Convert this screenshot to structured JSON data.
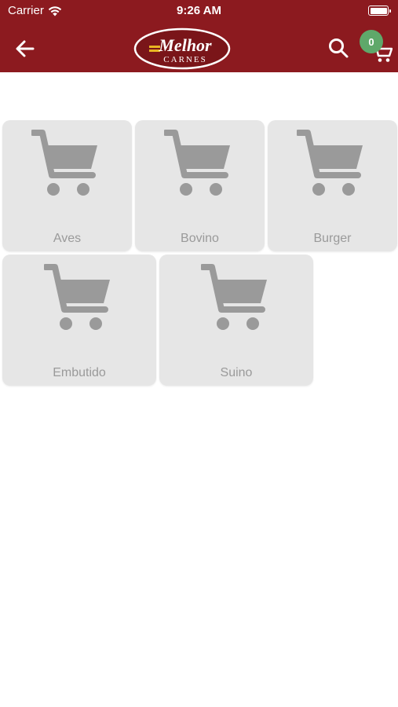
{
  "status_bar": {
    "carrier": "Carrier",
    "time": "9:26 AM",
    "wifi_icon": "wifi-icon",
    "battery_icon": "battery-icon"
  },
  "header": {
    "background_color": "#8c1a1f",
    "back_icon": "arrow-left-icon",
    "logo": {
      "text_top": "Melhor",
      "text_bottom": "CARNES"
    },
    "search_icon": "search-icon",
    "cart": {
      "icon": "cart-icon",
      "count": "0",
      "badge_color": "#5fa86a"
    }
  },
  "categories": [
    {
      "label": "Aves",
      "icon": "shopping-cart-icon"
    },
    {
      "label": "Bovino",
      "icon": "shopping-cart-icon"
    },
    {
      "label": "Burger",
      "icon": "shopping-cart-icon"
    },
    {
      "label": "Embutido",
      "icon": "shopping-cart-icon"
    },
    {
      "label": "Suino",
      "icon": "shopping-cart-icon"
    }
  ],
  "colors": {
    "card_background": "#e6e6e6",
    "card_icon": "#9a9a9a",
    "card_text": "#9a9a9a"
  }
}
